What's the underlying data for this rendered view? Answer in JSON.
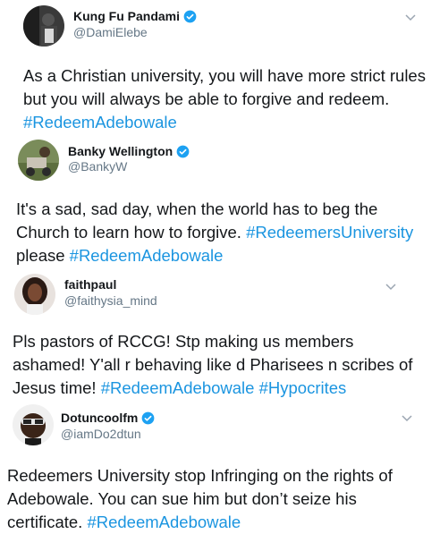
{
  "colors": {
    "text": "#14171a",
    "secondary": "#657786",
    "link": "#1b95e0",
    "verified": "#1da1f2"
  },
  "tweets": [
    {
      "name": "Kung Fu Pandami",
      "handle": "@DamiElebe",
      "verified": true,
      "lines": [
        [
          {
            "t": "As a Christian university, you will have more strict rules"
          }
        ],
        [
          {
            "t": "but you will always be able to forgive and redeem."
          }
        ],
        [
          {
            "t": "#RedeemAdebowale",
            "tag": true
          }
        ]
      ]
    },
    {
      "name": "Banky Wellington",
      "handle": "@BankyW",
      "verified": true,
      "lines": [
        [
          {
            "t": "It's a sad, sad day, when the world has to beg the"
          }
        ],
        [
          {
            "t": "Church to learn how to forgive. "
          },
          {
            "t": "#RedeemersUniversity",
            "tag": true
          }
        ],
        [
          {
            "t": "please "
          },
          {
            "t": "#RedeemAdebowale",
            "tag": true
          }
        ]
      ]
    },
    {
      "name": "faithpaul",
      "handle": "@faithysia_mind",
      "verified": false,
      "lines": [
        [
          {
            "t": "Pls pastors of RCCG! Stp making us members"
          }
        ],
        [
          {
            "t": "ashamed! Y'all r behaving like d Pharisees n scribes of"
          }
        ],
        [
          {
            "t": "Jesus time! "
          },
          {
            "t": "#RedeemAdebowale",
            "tag": true
          },
          {
            "t": " "
          },
          {
            "t": "#Hypocrites",
            "tag": true
          }
        ]
      ]
    },
    {
      "name": "Dotuncoolfm",
      "handle": "@iamDo2dtun",
      "verified": true,
      "lines": [
        [
          {
            "t": "Redeemers University stop Infringing on the rights of"
          }
        ],
        [
          {
            "t": "Adebowale. You can sue him but don’t seize his"
          }
        ],
        [
          {
            "t": "certificate. "
          },
          {
            "t": "#RedeemAdebowale",
            "tag": true
          }
        ]
      ]
    }
  ]
}
